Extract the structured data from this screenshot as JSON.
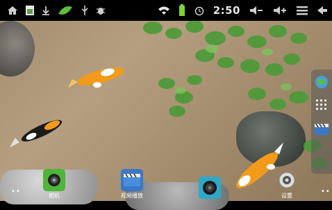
{
  "status_bar": {
    "time": "2:50",
    "left_icons": [
      "home-icon",
      "gallery-icon",
      "download-icon",
      "peas-game-icon",
      "usb-icon",
      "debug-icon"
    ],
    "right_icons": [
      "wifi-icon",
      "battery-icon",
      "alarm-icon",
      "volume-down-icon",
      "volume-up-icon",
      "menu-icon",
      "back-icon"
    ]
  },
  "dock": {
    "apps": [
      {
        "label": "相机",
        "icon": "camera-icon"
      },
      {
        "label": "视频播放",
        "icon": "video-player-icon"
      },
      {
        "label": "",
        "icon": "speaker-icon"
      },
      {
        "label": "设置",
        "icon": "settings-icon"
      }
    ]
  },
  "right_dock": {
    "items": [
      "globe-icon",
      "app-grid-icon",
      "video-clip-icon"
    ]
  },
  "colors": {
    "status_bar_bg": "#000000",
    "sand": "#a89172",
    "koi_orange": "#f29a1a",
    "leaf_green": "#4f9a3a"
  }
}
